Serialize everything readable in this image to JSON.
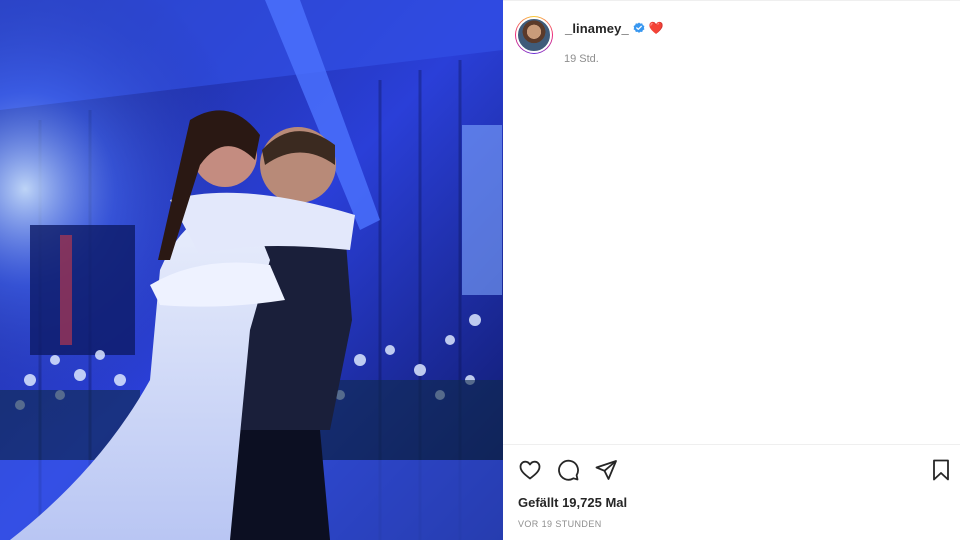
{
  "post": {
    "image_alt": "",
    "author": {
      "username": "_linamey_",
      "verified_icon": "verified-badge-icon",
      "emoji": "❤️"
    },
    "time_ago": "19 Std.",
    "actions": {
      "like_icon": "heart-icon",
      "comment_icon": "comment-icon",
      "share_icon": "paper-plane-icon",
      "save_icon": "bookmark-icon"
    },
    "likes_text": "Gefällt 19,725 Mal",
    "posted_text": "VOR 19 STUNDEN"
  },
  "colors": {
    "text_primary": "#262626",
    "text_secondary": "#8e8e8e",
    "verified_blue": "#3897f0",
    "photo_blue": "#1f3ad6"
  }
}
